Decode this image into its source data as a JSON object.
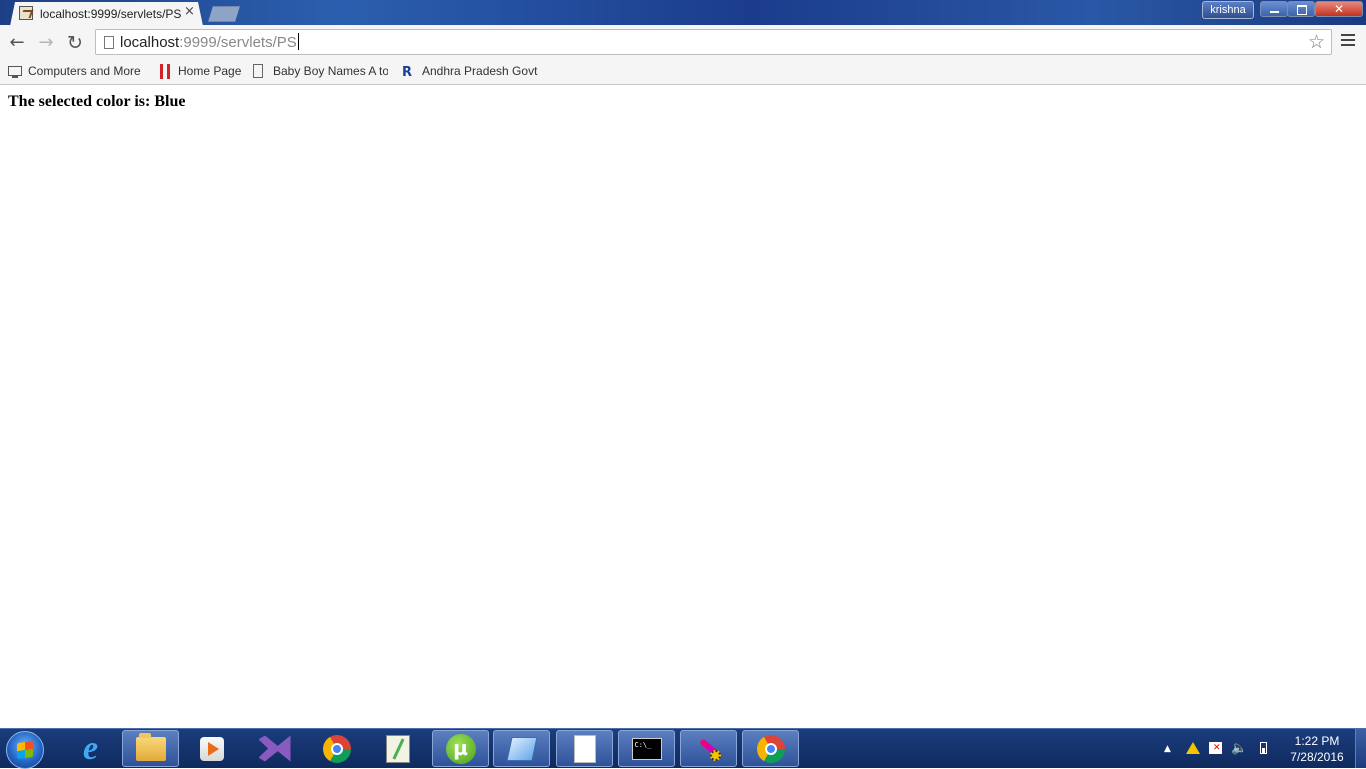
{
  "browser": {
    "tab": {
      "title": "localhost:9999/servlets/PS",
      "close_glyph": "×"
    },
    "user_badge": "krishna",
    "window_close_glyph": "✕",
    "nav": {
      "back_glyph": "←",
      "forward_glyph": "→",
      "reload_glyph": "↻"
    },
    "address": {
      "host": "localhost",
      "path": ":9999/servlets/PS"
    },
    "star_glyph": "☆",
    "bookmarks": [
      {
        "label": "Computers and More",
        "icon": "monitor-icon"
      },
      {
        "label": "Home Page",
        "icon": "red-bars-icon"
      },
      {
        "label": "Baby Boy Names A to",
        "icon": "page-icon"
      },
      {
        "label": "Andhra Pradesh Govt",
        "icon": "ap-logo-icon"
      }
    ]
  },
  "page": {
    "message": "The selected color is: Blue"
  },
  "taskbar": {
    "cmd_label": "C:\\_",
    "utorrent_label": "µ",
    "ie_label": "e",
    "tray": {
      "arrow_glyph": "▲",
      "volume_glyph": "🔈"
    },
    "clock": {
      "time": "1:22 PM",
      "date": "7/28/2016"
    }
  },
  "colors": {
    "taskbar": "#12326e",
    "titlebar": "#1d3f86",
    "toolbar": "#f5f5f5"
  }
}
